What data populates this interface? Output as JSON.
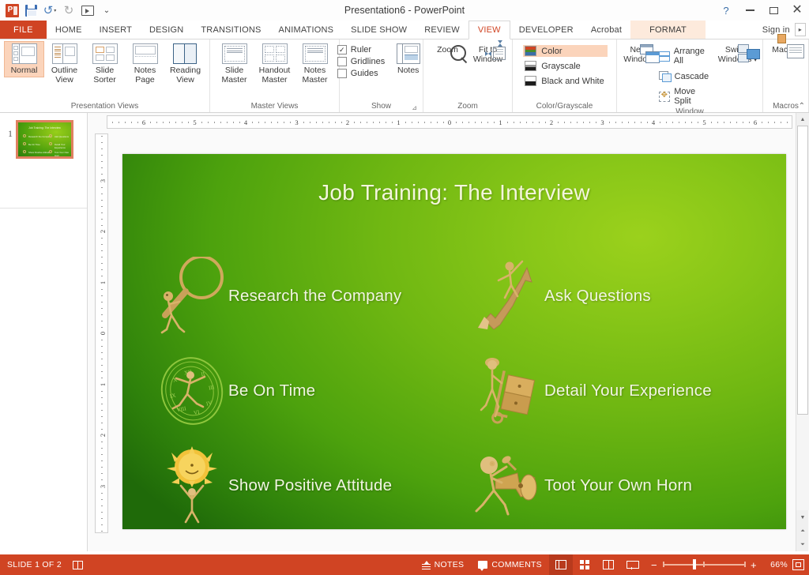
{
  "window": {
    "title": "Presentation6 - PowerPoint",
    "quick_access": [
      {
        "name": "powerpoint-logo",
        "label": "PowerPoint"
      },
      {
        "name": "save-icon",
        "label": "Save"
      },
      {
        "name": "undo-icon",
        "label": "Undo"
      },
      {
        "name": "redo-icon",
        "label": "Redo"
      },
      {
        "name": "start-presentation-icon",
        "label": "Start From Beginning"
      },
      {
        "name": "customize-qat-icon",
        "label": "Customize Quick Access Toolbar"
      }
    ],
    "controls": {
      "help": "?",
      "minimize": "Minimize",
      "restore": "Restore Down",
      "close": "✕"
    }
  },
  "tabs": {
    "file": "FILE",
    "items": [
      {
        "label": "HOME",
        "active": false
      },
      {
        "label": "INSERT",
        "active": false
      },
      {
        "label": "DESIGN",
        "active": false
      },
      {
        "label": "TRANSITIONS",
        "active": false
      },
      {
        "label": "ANIMATIONS",
        "active": false
      },
      {
        "label": "SLIDE SHOW",
        "active": false
      },
      {
        "label": "REVIEW",
        "active": false
      },
      {
        "label": "VIEW",
        "active": true
      },
      {
        "label": "DEVELOPER",
        "active": false
      },
      {
        "label": "Acrobat",
        "active": false
      }
    ],
    "contextual": "FORMAT",
    "signin": "Sign in",
    "expand": "▸"
  },
  "ribbon": {
    "groups": [
      {
        "name": "presentation-views",
        "label": "Presentation Views",
        "buttons": [
          {
            "label": "Normal",
            "selected": true
          },
          {
            "label": "Outline View",
            "selected": false
          },
          {
            "label": "Slide Sorter",
            "selected": false
          },
          {
            "label": "Notes Page",
            "selected": false
          },
          {
            "label": "Reading View",
            "selected": false
          }
        ]
      },
      {
        "name": "master-views",
        "label": "Master Views",
        "buttons": [
          {
            "label": "Slide Master",
            "selected": false
          },
          {
            "label": "Handout Master",
            "selected": false
          },
          {
            "label": "Notes Master",
            "selected": false
          }
        ]
      },
      {
        "name": "show",
        "label": "Show",
        "checkboxes": [
          {
            "label": "Ruler",
            "checked": true
          },
          {
            "label": "Gridlines",
            "checked": false
          },
          {
            "label": "Guides",
            "checked": false
          }
        ],
        "notes_button": "Notes"
      },
      {
        "name": "zoom",
        "label": "Zoom",
        "buttons": [
          {
            "label": "Zoom"
          },
          {
            "label": "Fit to Window"
          }
        ]
      },
      {
        "name": "color-grayscale",
        "label": "Color/Grayscale",
        "items": [
          {
            "label": "Color",
            "selected": true
          },
          {
            "label": "Grayscale",
            "selected": false
          },
          {
            "label": "Black and White",
            "selected": false
          }
        ]
      },
      {
        "name": "window",
        "label": "Window",
        "buttons": [
          {
            "label": "New Window"
          },
          {
            "label": "Arrange All"
          },
          {
            "label": "Cascade"
          },
          {
            "label": "Move Split"
          },
          {
            "label": "Switch Windows"
          }
        ]
      },
      {
        "name": "macros",
        "label": "Macros",
        "buttons": [
          {
            "label": "Macros"
          }
        ]
      }
    ],
    "collapse": "⌃"
  },
  "thumbnails": {
    "slides": [
      {
        "number": "1",
        "selected": true
      }
    ]
  },
  "rulers": {
    "horizontal": [
      "6",
      "5",
      "4",
      "3",
      "2",
      "1",
      "0",
      "1",
      "2",
      "3",
      "4",
      "5",
      "6"
    ],
    "vertical": [
      "3",
      "2",
      "1",
      "0",
      "1",
      "2",
      "3"
    ]
  },
  "slide": {
    "title": "Job Training: The Interview",
    "background_colors": {
      "light": "#9bd11c",
      "mid": "#6fb712",
      "dark": "#1f6a09"
    },
    "text_color": "#f1f5e2",
    "figure_color": "#d9b36b",
    "items": [
      {
        "label": "Research the Company",
        "icon": "magnifying-glass-figure-icon",
        "column": "left",
        "row": 1
      },
      {
        "label": "Ask Questions",
        "icon": "arrow-climbing-figure-icon",
        "column": "right",
        "row": 1
      },
      {
        "label": "Be On Time",
        "icon": "clock-figure-icon",
        "column": "left",
        "row": 2
      },
      {
        "label": "Detail Your Experience",
        "icon": "hand-truck-boxes-figure-icon",
        "column": "right",
        "row": 2
      },
      {
        "label": "Show Positive Attitude",
        "icon": "sun-lifting-figure-icon",
        "column": "left",
        "row": 3
      },
      {
        "label": "Toot Your Own Horn",
        "icon": "horn-figure-icon",
        "column": "right",
        "row": 3
      }
    ]
  },
  "statusbar": {
    "slide_count": "SLIDE 1 OF 2",
    "language_icon": "reading-mode-icon",
    "notes": "NOTES",
    "comments": "COMMENTS",
    "views": [
      {
        "name": "normal-view-button",
        "active": true
      },
      {
        "name": "slide-sorter-button",
        "active": false
      },
      {
        "name": "reading-view-button",
        "active": false
      },
      {
        "name": "slide-show-button",
        "active": false
      }
    ],
    "zoom_out": "−",
    "zoom_in": "+",
    "zoom_level": "66%",
    "fit_slide": "Fit slide to current window",
    "accent_color": "#d04423"
  }
}
